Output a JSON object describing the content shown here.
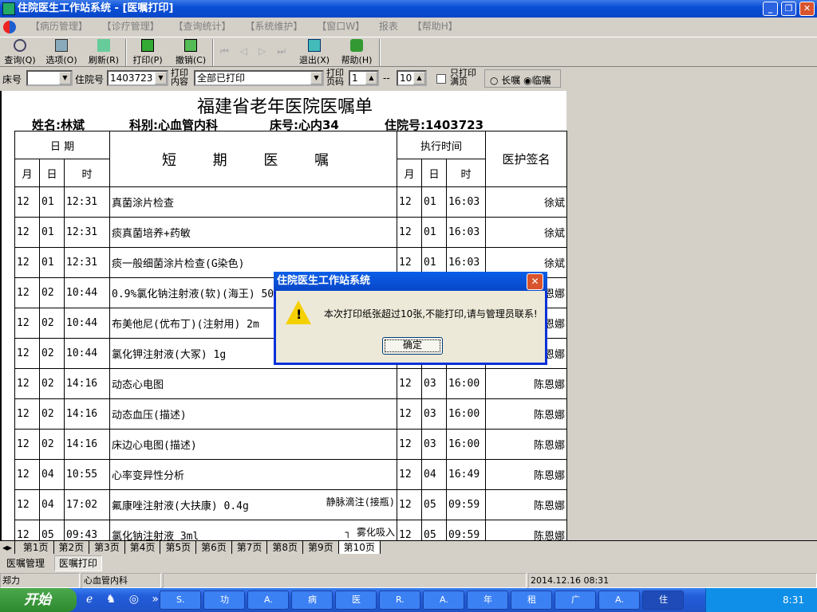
{
  "window": {
    "title": "住院医生工作站系统 - [医嘱打印]"
  },
  "menu": [
    "【病历管理】",
    "【诊疗管理】",
    "【查询统计】",
    "【系统维护】",
    "【窗口W】",
    "报表",
    "【帮助H】"
  ],
  "toolbar": {
    "query": "查询(Q)",
    "options": "选项(O)",
    "refresh": "刷新(R)",
    "print": "打印(P)",
    "undo": "撤销(C)",
    "exit": "退出(X)",
    "help": "帮助(H)"
  },
  "filter": {
    "bed_label": "床号",
    "bed_value": "",
    "inpatient_label": "住院号",
    "inpatient_value": "1403723",
    "content_label": "打印内容",
    "content_value": "全部已打印",
    "page_label": "打印页码",
    "page_from": "1",
    "dash": "--",
    "page_to": "10",
    "fullpage_label": "只打印满页",
    "radio_long": "长嘱",
    "radio_temp": "临嘱"
  },
  "document": {
    "title": "福建省老年医院医嘱单",
    "name": "姓名:林斌",
    "dept": "科别:心血管内科",
    "bed": "床号:心内34",
    "inpatient": "住院号:1403723",
    "headers": {
      "date": "日 期",
      "month": "月",
      "day": "日",
      "time": "时",
      "orders": "短 期 医 嘱",
      "exec": "执行时间",
      "sign": "医护签名"
    },
    "rows": [
      [
        "12",
        "01",
        "12:31",
        "真菌涂片检查",
        "",
        "12",
        "01",
        "16:03",
        "徐斌"
      ],
      [
        "12",
        "01",
        "12:31",
        "痰真菌培养+药敏",
        "",
        "12",
        "01",
        "16:03",
        "徐斌"
      ],
      [
        "12",
        "01",
        "12:31",
        "痰一般细菌涂片检查(G染色)",
        "",
        "12",
        "01",
        "16:03",
        "徐斌"
      ],
      [
        "12",
        "02",
        "10:44",
        "0.9%氯化钠注射液(软)(海王)  50m",
        "",
        "",
        "",
        "",
        "陈恩娜"
      ],
      [
        "12",
        "02",
        "10:44",
        "布美他尼(优布丁)(注射用)  2m",
        "",
        "",
        "",
        "",
        "陈恩娜"
      ],
      [
        "12",
        "02",
        "10:44",
        "氯化钾注射液(大冢)  1g",
        "",
        "",
        "",
        "",
        "陈恩娜"
      ],
      [
        "12",
        "02",
        "14:16",
        "动态心电图",
        "",
        "12",
        "03",
        "16:00",
        "陈恩娜"
      ],
      [
        "12",
        "02",
        "14:16",
        "动态血压(描述)",
        "",
        "12",
        "03",
        "16:00",
        "陈恩娜"
      ],
      [
        "12",
        "02",
        "14:16",
        "床边心电图(描述)",
        "",
        "12",
        "03",
        "16:00",
        "陈恩娜"
      ],
      [
        "12",
        "04",
        "10:55",
        "心率变异性分析",
        "",
        "12",
        "04",
        "16:49",
        "陈恩娜"
      ],
      [
        "12",
        "04",
        "17:02",
        "氟康唑注射液(大扶康) 0.4g",
        "静脉滴注(接瓶)",
        "12",
        "05",
        "09:59",
        "陈恩娜"
      ],
      [
        "12",
        "05",
        "09:43",
        "氯化钠注射液 3ml",
        "┐ 雾化吸入",
        "12",
        "05",
        "09:59",
        "陈恩娜"
      ]
    ]
  },
  "page_tabs": [
    "第1页",
    "第2页",
    "第3页",
    "第4页",
    "第5页",
    "第6页",
    "第7页",
    "第8页",
    "第9页",
    "第10页"
  ],
  "bottom_tabs": [
    "医嘱管理",
    "医嘱打印"
  ],
  "status": {
    "user": "郑力",
    "dept": "心血管内科",
    "datetime": "2014.12.16 08:31"
  },
  "taskbar": {
    "start": "开始",
    "tasks": [
      "S.",
      "功",
      "A.",
      "病",
      "医",
      "R.",
      "A.",
      "年",
      "租",
      "广",
      "A.",
      "住"
    ],
    "clock": "8:31"
  },
  "dialog": {
    "title": "住院医生工作站系统",
    "message": "本次打印纸张超过10张,不能打印,请与管理员联系!",
    "ok": "确定"
  }
}
